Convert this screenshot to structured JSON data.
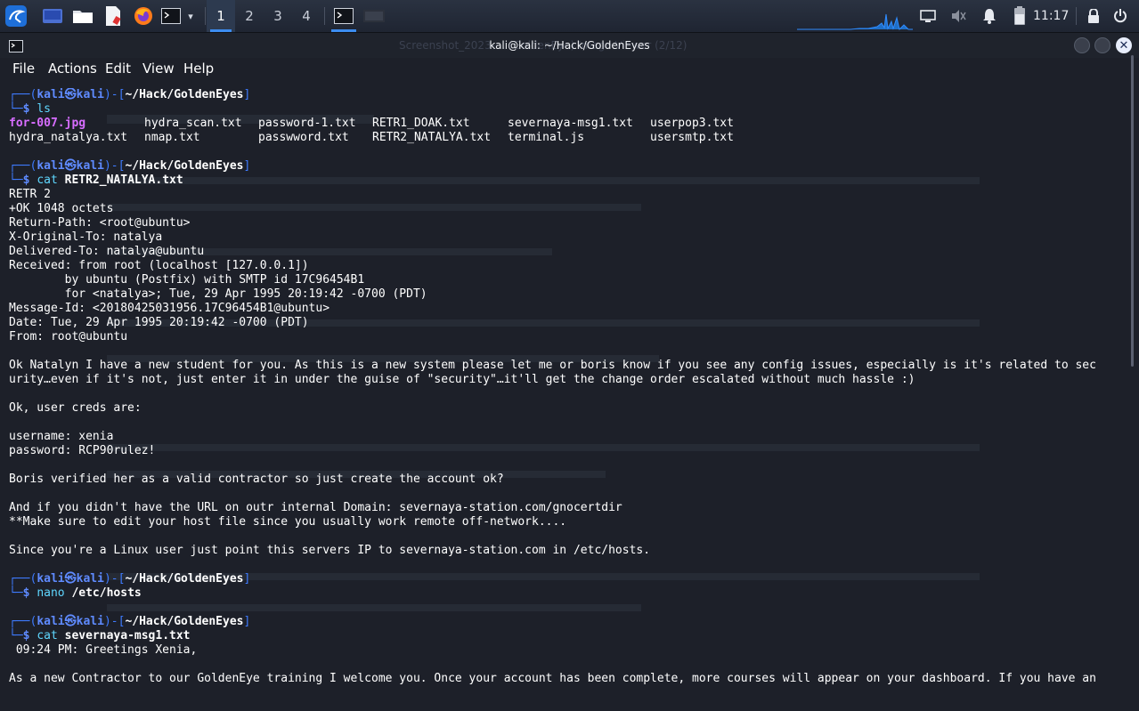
{
  "panel": {
    "workspaces": [
      "1",
      "2",
      "3",
      "4"
    ],
    "clock": "11:17",
    "icons": [
      "kali-menu-icon",
      "show-desktop-icon",
      "file-manager-icon",
      "text-editor-icon",
      "firefox-icon",
      "terminal-icon",
      "dropdown-chevron-icon",
      "screen-icon",
      "mute-icon",
      "notification-bell-icon",
      "battery-icon",
      "lock-icon",
      "power-icon"
    ]
  },
  "window": {
    "title": "kali@kali: ~/Hack/GoldenEyes",
    "ghost_title": "Screenshot_2023-... (GoldenEye) Image Viewer (2/12)",
    "menu": [
      "File",
      "Actions",
      "Edit",
      "View",
      "Help"
    ]
  },
  "prompt": {
    "user": "kali",
    "at": "㉿",
    "host": "kali",
    "dir": "~/Hack/GoldenEyes"
  },
  "terminal": {
    "cmd1": "ls",
    "ls_row1": [
      {
        "name": "for-007.jpg",
        "img": true
      },
      {
        "name": "hydra_scan.txt"
      },
      {
        "name": "password-1.txt"
      },
      {
        "name": "RETR1_DOAK.txt"
      },
      {
        "name": "severnaya-msg1.txt"
      },
      {
        "name": "userpop3.txt"
      }
    ],
    "ls_row2": [
      {
        "name": "hydra_natalya.txt"
      },
      {
        "name": "nmap.txt"
      },
      {
        "name": "passwword.txt"
      },
      {
        "name": "RETR2_NATALYA.txt"
      },
      {
        "name": "terminal.js"
      },
      {
        "name": "usersmtp.txt"
      }
    ],
    "cmd2": "cat",
    "cmd2_arg": "RETR2_NATALYA.txt",
    "mail": [
      "RETR 2",
      "+OK 1048 octets",
      "Return-Path: <root@ubuntu>",
      "X-Original-To: natalya",
      "Delivered-To: natalya@ubuntu",
      "Received: from root (localhost [127.0.0.1])",
      "        by ubuntu (Postfix) with SMTP id 17C96454B1",
      "        for <natalya>; Tue, 29 Apr 1995 20:19:42 -0700 (PDT)",
      "Message-Id: <20180425031956.17C96454B1@ubuntu>",
      "Date: Tue, 29 Apr 1995 20:19:42 -0700 (PDT)",
      "From: root@ubuntu",
      "",
      "Ok Natalyn I have a new student for you. As this is a new system please let me or boris know if you see any config issues, especially is it's related to sec",
      "urity…even if it's not, just enter it in under the guise of \"security\"…it'll get the change order escalated without much hassle :)",
      "",
      "Ok, user creds are:",
      "",
      "username: xenia",
      "password: RCP90rulez!",
      "",
      "Boris verified her as a valid contractor so just create the account ok?",
      "",
      "And if you didn't have the URL on outr internal Domain: severnaya-station.com/gnocertdir",
      "**Make sure to edit your host file since you usually work remote off-network....",
      "",
      "Since you're a Linux user just point this servers IP to severnaya-station.com in /etc/hosts."
    ],
    "cmd3": "nano",
    "cmd3_arg": "/etc/hosts",
    "cmd4": "cat",
    "cmd4_arg": "severnaya-msg1.txt",
    "msg1": [
      " 09:24 PM: Greetings Xenia,",
      "",
      "As a new Contractor to our GoldenEye training I welcome you. Once your account has been complete, more courses will appear on your dashboard. If you have an"
    ]
  }
}
